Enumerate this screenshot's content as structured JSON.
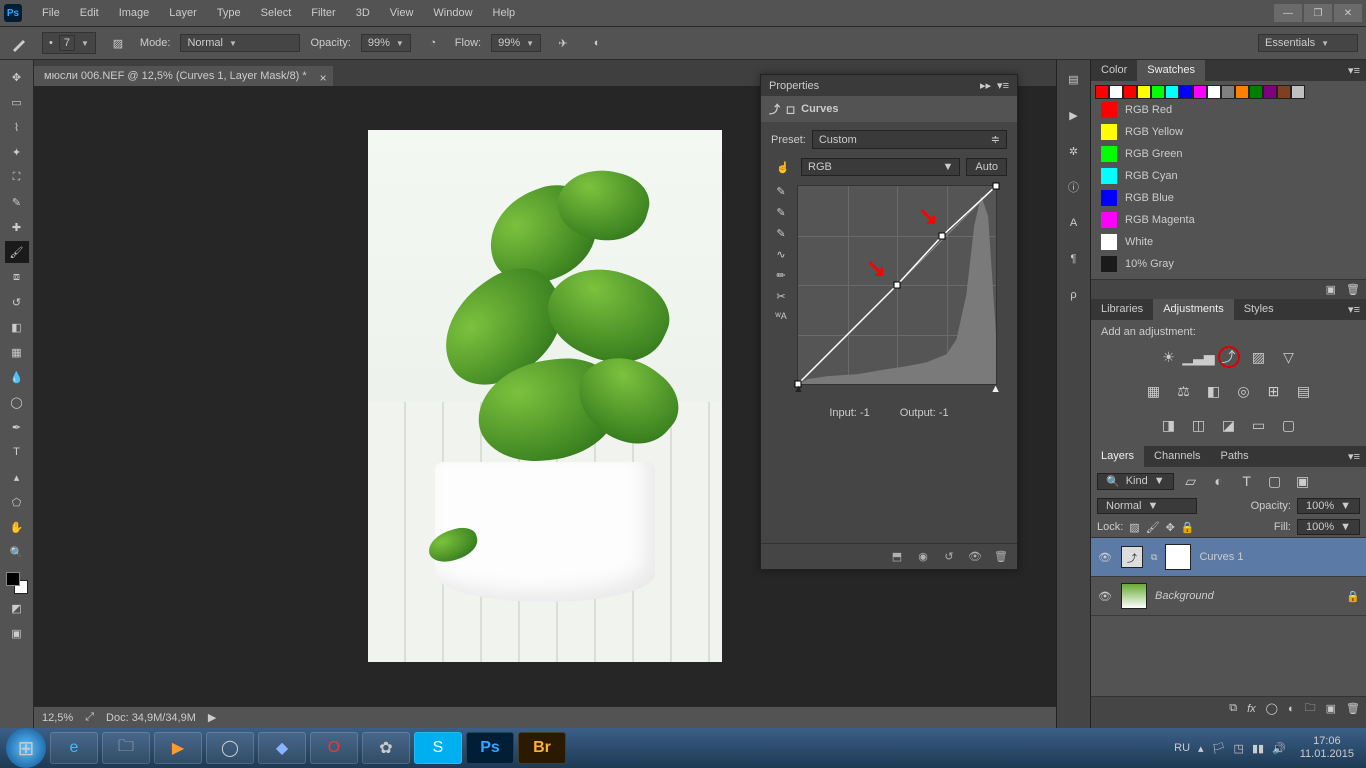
{
  "menu": [
    "File",
    "Edit",
    "Image",
    "Layer",
    "Type",
    "Select",
    "Filter",
    "3D",
    "View",
    "Window",
    "Help"
  ],
  "workspace": "Essentials",
  "opt": {
    "size": "7",
    "mode_lbl": "Mode:",
    "mode": "Normal",
    "opac_lbl": "Opacity:",
    "opac": "99%",
    "flow_lbl": "Flow:",
    "flow": "99%"
  },
  "doc": {
    "tab": "мюсли 006.NEF @ 12,5% (Curves 1, Layer Mask/8) *",
    "zoom": "12,5%",
    "status": "Doc: 34,9M/34,9M"
  },
  "props": {
    "title": "Properties",
    "sub": "Curves",
    "preset_lbl": "Preset:",
    "preset": "Custom",
    "channel": "RGB",
    "auto": "Auto",
    "input_lbl": "Input:",
    "input": "-1",
    "output_lbl": "Output:",
    "output": "-1"
  },
  "colorTabs": [
    "Color",
    "Swatches"
  ],
  "swStrip": [
    "#ff0000",
    "#ffffff",
    "#ff0000",
    "#ffff00",
    "#00ff00",
    "#00ffff",
    "#0000ff",
    "#ff00ff",
    "#ffffff",
    "#808080",
    "#ff8000",
    "#008000",
    "#800080",
    "#804020",
    "#c0c0c0"
  ],
  "swList": [
    {
      "c": "#ff0000",
      "n": "RGB Red"
    },
    {
      "c": "#ffff00",
      "n": "RGB Yellow"
    },
    {
      "c": "#00ff00",
      "n": "RGB Green"
    },
    {
      "c": "#00ffff",
      "n": "RGB Cyan"
    },
    {
      "c": "#0000ff",
      "n": "RGB Blue"
    },
    {
      "c": "#ff00ff",
      "n": "RGB Magenta"
    },
    {
      "c": "#ffffff",
      "n": "White"
    },
    {
      "c": "#1a1a1a",
      "n": "10% Gray"
    }
  ],
  "adjTabs": [
    "Libraries",
    "Adjustments",
    "Styles"
  ],
  "adjTitle": "Add an adjustment:",
  "layTabs": [
    "Layers",
    "Channels",
    "Paths"
  ],
  "lay": {
    "kind": "Kind",
    "mode": "Normal",
    "opac_lbl": "Opacity:",
    "opac": "100%",
    "lock_lbl": "Lock:",
    "fill_lbl": "Fill:",
    "fill": "100%",
    "items": [
      {
        "n": "Curves 1"
      },
      {
        "n": "Background"
      }
    ]
  },
  "tray": {
    "lang": "RU",
    "time": "17:06",
    "date": "11.01.2015"
  },
  "chart_data": {
    "type": "line",
    "title": "Curves — RGB",
    "xlabel": "Input",
    "ylabel": "Output",
    "xlim": [
      0,
      255
    ],
    "ylim": [
      0,
      255
    ],
    "points": [
      {
        "x": 0,
        "y": 0
      },
      {
        "x": 128,
        "y": 128
      },
      {
        "x": 185,
        "y": 190
      },
      {
        "x": 255,
        "y": 255
      }
    ],
    "input": -1,
    "output": -1,
    "histogram_note": "grayscale histogram peaks strongly near whites (≈220-255) with low midtones"
  }
}
